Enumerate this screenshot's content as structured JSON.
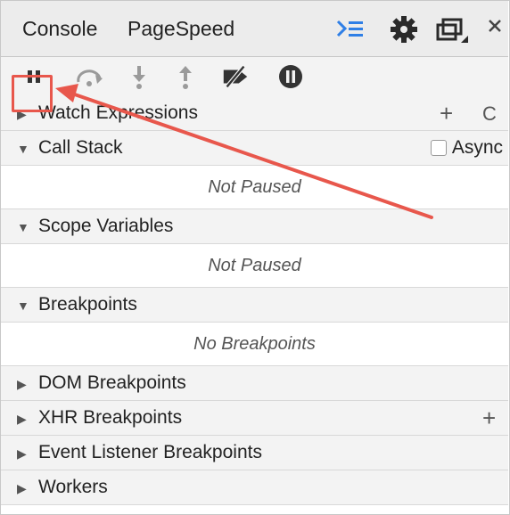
{
  "tabs": [
    {
      "label": "Console"
    },
    {
      "label": "PageSpeed"
    }
  ],
  "tab_icons": [
    "drawer-icon",
    "gear-icon",
    "dock-icon",
    "close-icon"
  ],
  "toolbar": {
    "buttons": [
      "pause-icon",
      "step-over-icon",
      "step-into-icon",
      "step-out-icon",
      "deactivate-breakpoints-icon",
      "pause-on-exceptions-icon"
    ]
  },
  "sections": {
    "watch": {
      "label": "Watch Expressions",
      "add": "+",
      "refresh": "C"
    },
    "call_stack": {
      "label": "Call Stack",
      "async_label": "Async",
      "empty": "Not Paused"
    },
    "scope": {
      "label": "Scope Variables",
      "empty": "Not Paused"
    },
    "breakpoints": {
      "label": "Breakpoints",
      "empty": "No Breakpoints"
    },
    "dom": {
      "label": "DOM Breakpoints"
    },
    "xhr": {
      "label": "XHR Breakpoints",
      "add": "+"
    },
    "event": {
      "label": "Event Listener Breakpoints"
    },
    "workers": {
      "label": "Workers"
    }
  },
  "colors": {
    "annotation": "#e8574c",
    "accent": "#2f7fe6"
  }
}
